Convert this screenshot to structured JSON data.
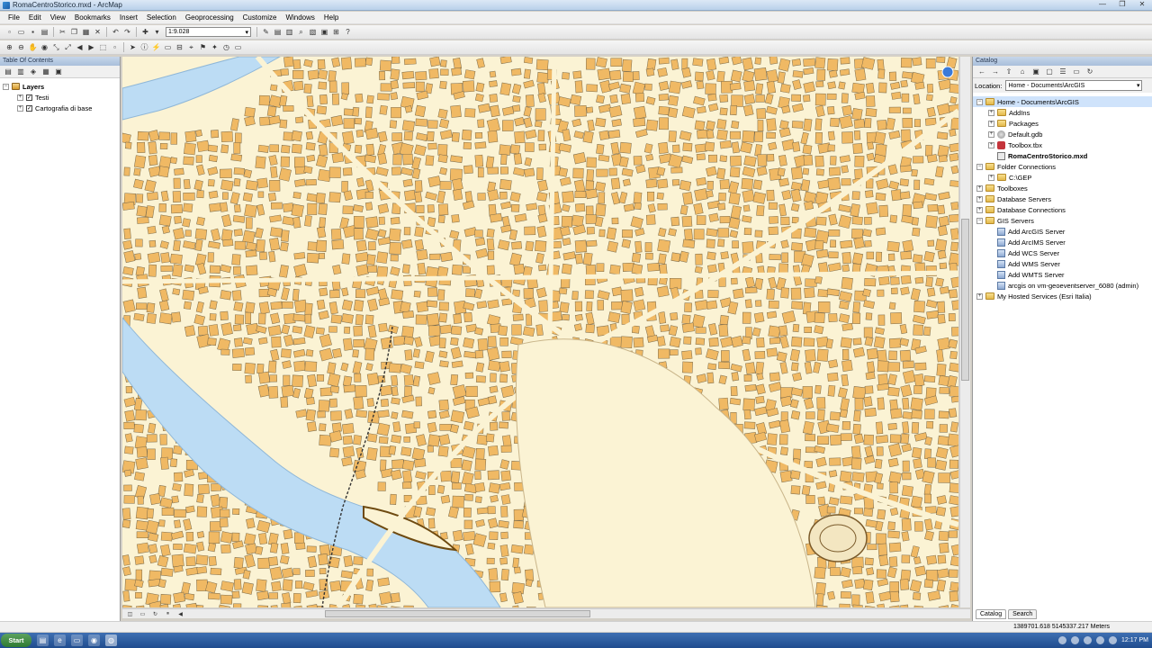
{
  "window": {
    "title": "RomaCentroStorico.mxd - ArcMap",
    "controls": [
      "—",
      "❐",
      "✕"
    ]
  },
  "menu": [
    "File",
    "Edit",
    "View",
    "Bookmarks",
    "Insert",
    "Selection",
    "Geoprocessing",
    "Customize",
    "Windows",
    "Help"
  ],
  "toolbar": {
    "scale": "1:9.028"
  },
  "toc": {
    "caption": "Table Of Contents",
    "root": "Layers",
    "layers": [
      {
        "name": "Testi",
        "checked": true
      },
      {
        "name": "Cartografia di base",
        "checked": true
      }
    ]
  },
  "catalog": {
    "caption": "Catalog",
    "location_label": "Location:",
    "location_value": "Home - Documents\\ArcGIS",
    "tree": [
      {
        "label": "Home - Documents\\ArcGIS",
        "level": 0,
        "icon": "folder",
        "selected": true
      },
      {
        "label": "AddIns",
        "level": 1,
        "icon": "folder"
      },
      {
        "label": "Packages",
        "level": 1,
        "icon": "folder"
      },
      {
        "label": "Default.gdb",
        "level": 1,
        "icon": "gdb"
      },
      {
        "label": "Toolbox.tbx",
        "level": 1,
        "icon": "tbx"
      },
      {
        "label": "RomaCentroStorico.mxd",
        "level": 1,
        "icon": "mxd",
        "bold": true
      },
      {
        "label": "Folder Connections",
        "level": 0,
        "icon": "folder"
      },
      {
        "label": "C:\\GEP",
        "level": 1,
        "icon": "folder"
      },
      {
        "label": "Toolboxes",
        "level": 0,
        "icon": "folder"
      },
      {
        "label": "Database Servers",
        "level": 0,
        "icon": "folder"
      },
      {
        "label": "Database Connections",
        "level": 0,
        "icon": "folder"
      },
      {
        "label": "GIS Servers",
        "level": 0,
        "icon": "folder"
      },
      {
        "label": "Add ArcGIS Server",
        "level": 1,
        "icon": "srv"
      },
      {
        "label": "Add ArcIMS Server",
        "level": 1,
        "icon": "srv"
      },
      {
        "label": "Add WCS Server",
        "level": 1,
        "icon": "srv"
      },
      {
        "label": "Add WMS Server",
        "level": 1,
        "icon": "srv"
      },
      {
        "label": "Add WMTS Server",
        "level": 1,
        "icon": "srv"
      },
      {
        "label": "arcgis on vm-geoeventserver_6080 (admin)",
        "level": 1,
        "icon": "srv"
      },
      {
        "label": "My Hosted Services (Esri Italia)",
        "level": 0,
        "icon": "folder"
      }
    ],
    "tabs": [
      "Catalog",
      "Search"
    ]
  },
  "status": {
    "coords": "1389701.618  5145337.217 Meters"
  },
  "taskbar": {
    "start": "Start",
    "time": "12:17 PM"
  },
  "colors": {
    "building": "#f0b964",
    "road": "#fbf3d4",
    "river": "#bcdcf4",
    "map_bg": "#fbf3d4"
  }
}
